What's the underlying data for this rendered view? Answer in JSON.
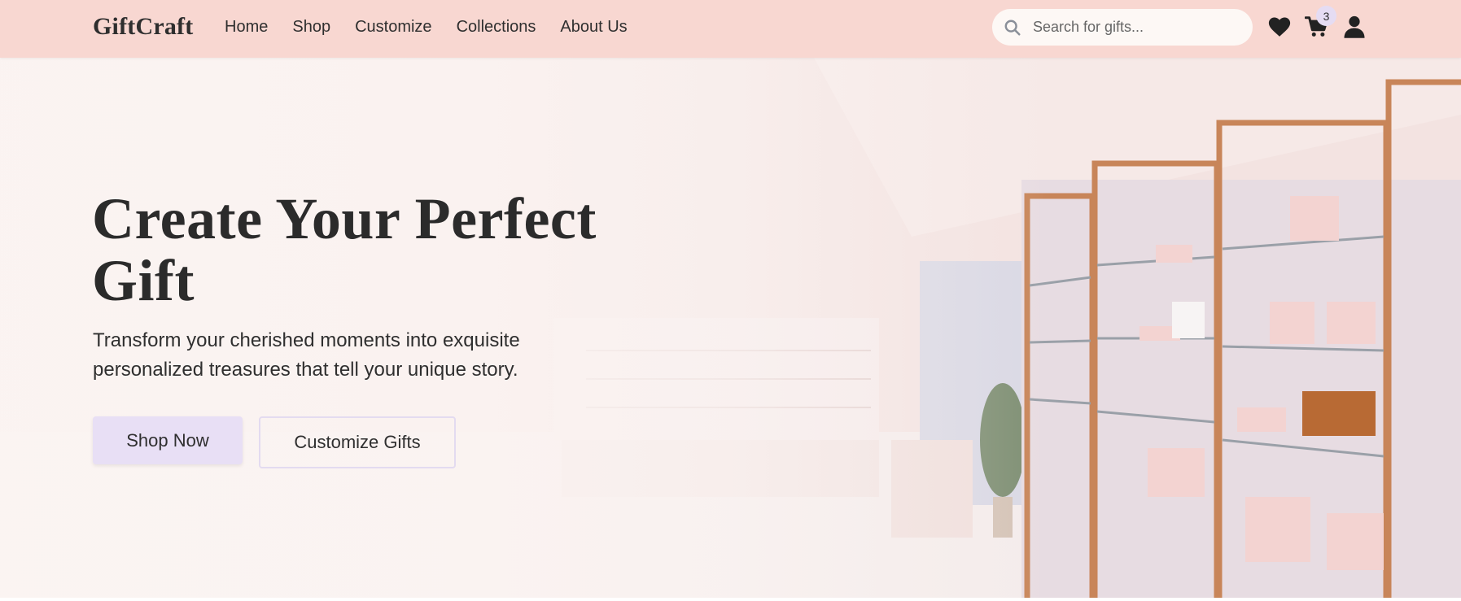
{
  "brand": {
    "name": "GiftCraft"
  },
  "nav": {
    "items": [
      {
        "label": "Home"
      },
      {
        "label": "Shop"
      },
      {
        "label": "Customize"
      },
      {
        "label": "Collections"
      },
      {
        "label": "About Us"
      }
    ]
  },
  "search": {
    "placeholder": "Search for gifts...",
    "icon": "search-icon"
  },
  "header_icons": {
    "wishlist": "heart-icon",
    "cart": "cart-icon",
    "cart_count": "3",
    "account": "user-icon"
  },
  "hero": {
    "title_line1": "Create Your Perfect",
    "title_line2": "Gift",
    "subtitle_line1": "Transform your cherished moments into exquisite",
    "subtitle_line2": "personalized treasures that tell your unique story.",
    "primary_button": "Shop Now",
    "secondary_button": "Customize Gifts",
    "background_image": "pink gift boutique interior with illuminated glass display shelves"
  },
  "colors": {
    "navbar": "#f8d7d1",
    "primary_button": "#e8dff5",
    "secondary_border": "#e3dbf0",
    "text": "#2f2f2f"
  }
}
